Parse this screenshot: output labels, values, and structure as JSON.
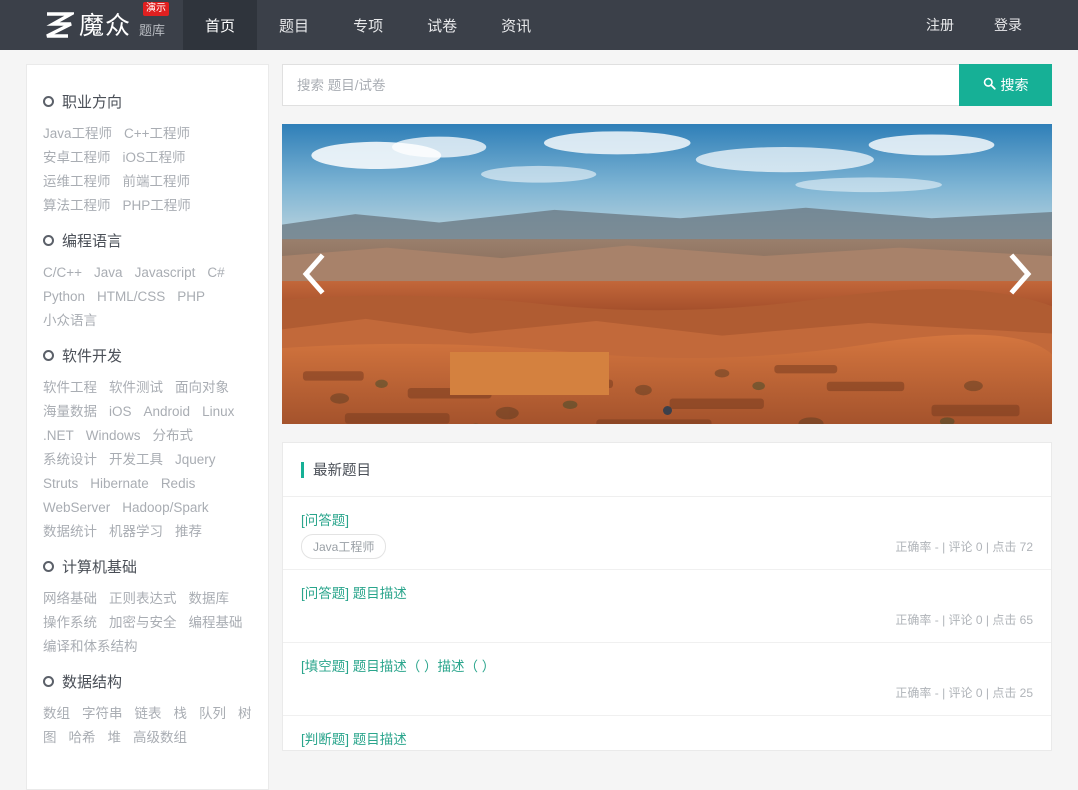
{
  "header": {
    "logo_text": "魔众",
    "logo_sub": "题库",
    "logo_badge": "演示",
    "nav": [
      {
        "label": "首页",
        "active": true
      },
      {
        "label": "题目",
        "active": false
      },
      {
        "label": "专项",
        "active": false
      },
      {
        "label": "试卷",
        "active": false
      },
      {
        "label": "资讯",
        "active": false
      }
    ],
    "auth": [
      {
        "label": "注册"
      },
      {
        "label": "登录"
      }
    ],
    "bg_color": "#3b4049",
    "active_bg_color": "#2f343c"
  },
  "search": {
    "placeholder": "搜索 题目/试卷",
    "value": "",
    "button_label": "搜索",
    "button_color": "#16b096",
    "icon": "search-icon"
  },
  "sidebar": {
    "sections": [
      {
        "title": "职业方向",
        "tags": [
          "Java工程师",
          "C++工程师",
          "安卓工程师",
          "iOS工程师",
          "运维工程师",
          "前端工程师",
          "算法工程师",
          "PHP工程师"
        ]
      },
      {
        "title": "编程语言",
        "tags": [
          "C/C++",
          "Java",
          "Javascript",
          "C#",
          "Python",
          "HTML/CSS",
          "PHP",
          "小众语言"
        ]
      },
      {
        "title": "软件开发",
        "tags": [
          "软件工程",
          "软件测试",
          "面向对象",
          "海量数据",
          "iOS",
          "Android",
          "Linux",
          ".NET",
          "Windows",
          "分布式",
          "系统设计",
          "开发工具",
          "Jquery",
          "Struts",
          "Hibernate",
          "Redis",
          "WebServer",
          "Hadoop/Spark",
          "数据统计",
          "机器学习",
          "推荐"
        ]
      },
      {
        "title": "计算机基础",
        "tags": [
          "网络基础",
          "正则表达式",
          "数据库",
          "操作系统",
          "加密与安全",
          "编程基础",
          "编译和体系结构"
        ]
      },
      {
        "title": "数据结构",
        "tags": [
          "数组",
          "字符串",
          "链表",
          "栈",
          "队列",
          "树",
          "图",
          "哈希",
          "堆",
          "高级数组"
        ]
      }
    ]
  },
  "carousel": {
    "prev_icon": "chevron-left-icon",
    "next_icon": "chevron-right-icon",
    "dots": 1,
    "active_dot": 0,
    "caption_color": "#d4813f",
    "image_alt": "红色岩石峡谷风景"
  },
  "latest": {
    "panel_title": "最新题目",
    "accent_color": "#16b096",
    "items": [
      {
        "type": "[问答题]",
        "desc": "",
        "tag": "Java工程师",
        "stats": "正确率 - | 评论 0 | 点击 72"
      },
      {
        "type": "[问答题]",
        "desc": "题目描述",
        "tag": "",
        "stats": "正确率 - | 评论 0 | 点击 65"
      },
      {
        "type": "[填空题]",
        "desc": "题目描述（ ）描述（ ）",
        "tag": "",
        "stats": "正确率 - | 评论 0 | 点击 25"
      },
      {
        "type": "[判断题]",
        "desc": "题目描述",
        "tag": "",
        "stats": ""
      }
    ]
  }
}
